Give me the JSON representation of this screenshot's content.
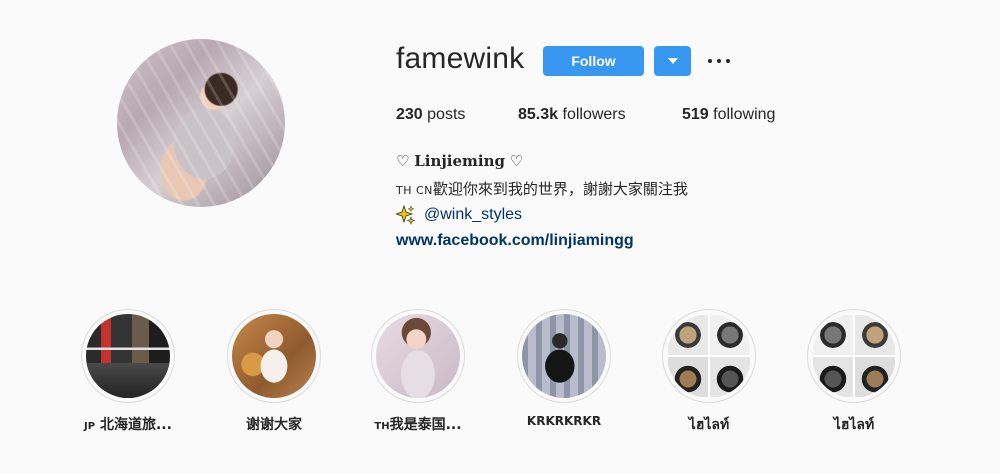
{
  "profile": {
    "username": "famewink",
    "follow_label": "Follow"
  },
  "stats": {
    "posts_count": "230",
    "posts_label": "posts",
    "followers_count": "85.3k",
    "followers_label": "followers",
    "following_count": "519",
    "following_label": "following"
  },
  "bio": {
    "name_prefix": "♡ ",
    "name": "𝐋𝐢𝐧𝐣𝐢𝐞𝐦𝐢𝐧𝐠",
    "name_suffix": " ♡",
    "flags": "TH CN",
    "welcome": "歡迎你來到我的世界，謝謝大家關注我",
    "handle": "@wink_styles",
    "link": "www.facebook.com/linjiamingg"
  },
  "highlights": [
    {
      "flag": "JP",
      "label": "北海道旅..."
    },
    {
      "flag": "",
      "label": "谢谢大家"
    },
    {
      "flag": "TH",
      "label": "我是泰国..."
    },
    {
      "flag": "",
      "label": "KRKRKRKR"
    },
    {
      "flag": "",
      "label": "ไฮไลท์"
    },
    {
      "flag": "",
      "label": "ไฮไลท์"
    }
  ],
  "colors": {
    "accent": "#3897f0",
    "link": "#003569",
    "text": "#262626",
    "background": "#fafafa"
  },
  "icons": {
    "dropdown": "chevron-down-icon",
    "more": "more-options-icon",
    "sparkle": "sparkles-icon"
  }
}
